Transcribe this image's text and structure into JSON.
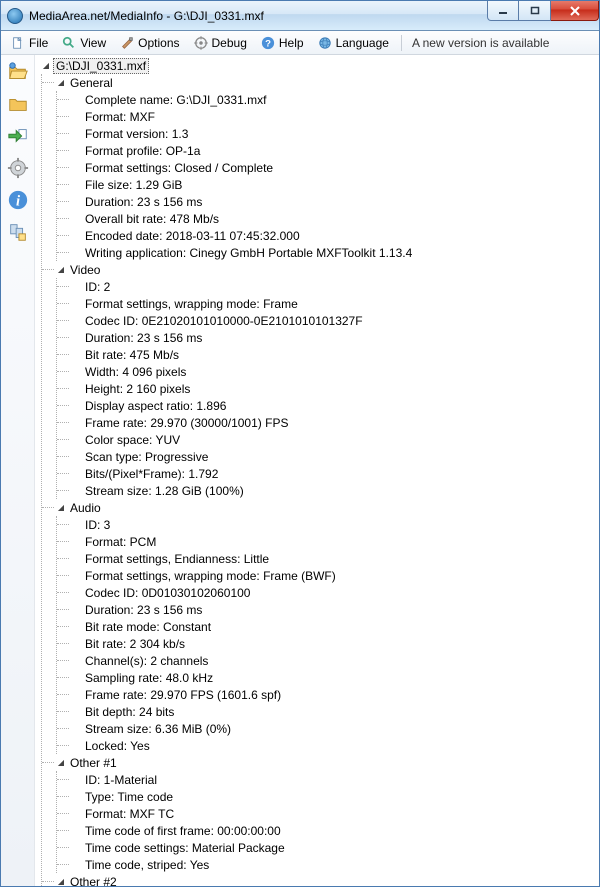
{
  "window": {
    "title": "MediaArea.net/MediaInfo - G:\\DJI_0331.mxf"
  },
  "menu": {
    "file": "File",
    "view": "View",
    "options": "Options",
    "debug": "Debug",
    "help": "Help",
    "language": "Language",
    "new_version": "A new version is available"
  },
  "tree": {
    "root": "G:\\DJI_0331.mxf",
    "sections": [
      {
        "name": "General",
        "items": [
          "Complete name: G:\\DJI_0331.mxf",
          "Format: MXF",
          "Format version: 1.3",
          "Format profile: OP-1a",
          "Format settings: Closed / Complete",
          "File size: 1.29 GiB",
          "Duration: 23 s 156 ms",
          "Overall bit rate: 478 Mb/s",
          "Encoded date: 2018-03-11 07:45:32.000",
          "Writing application: Cinegy GmbH Portable MXFToolkit 1.13.4"
        ]
      },
      {
        "name": "Video",
        "items": [
          "ID: 2",
          "Format settings, wrapping mode: Frame",
          "Codec ID: 0E21020101010000-0E2101010101327F",
          "Duration: 23 s 156 ms",
          "Bit rate: 475 Mb/s",
          "Width: 4 096 pixels",
          "Height: 2 160 pixels",
          "Display aspect ratio: 1.896",
          "Frame rate: 29.970 (30000/1001) FPS",
          "Color space: YUV",
          "Scan type: Progressive",
          "Bits/(Pixel*Frame): 1.792",
          "Stream size: 1.28 GiB (100%)"
        ]
      },
      {
        "name": "Audio",
        "items": [
          "ID: 3",
          "Format: PCM",
          "Format settings, Endianness: Little",
          "Format settings, wrapping mode: Frame (BWF)",
          "Codec ID: 0D01030102060100",
          "Duration: 23 s 156 ms",
          "Bit rate mode: Constant",
          "Bit rate: 2 304 kb/s",
          "Channel(s): 2 channels",
          "Sampling rate: 48.0 kHz",
          "Frame rate: 29.970 FPS (1601.6 spf)",
          "Bit depth: 24 bits",
          "Stream size: 6.36 MiB (0%)",
          "Locked: Yes"
        ]
      },
      {
        "name": "Other #1",
        "items": [
          "ID: 1-Material",
          "Type: Time code",
          "Format: MXF TC",
          "Time code of first frame: 00:00:00:00",
          "Time code settings: Material Package",
          "Time code, striped: Yes"
        ]
      },
      {
        "name": "Other #2",
        "items": []
      }
    ]
  }
}
